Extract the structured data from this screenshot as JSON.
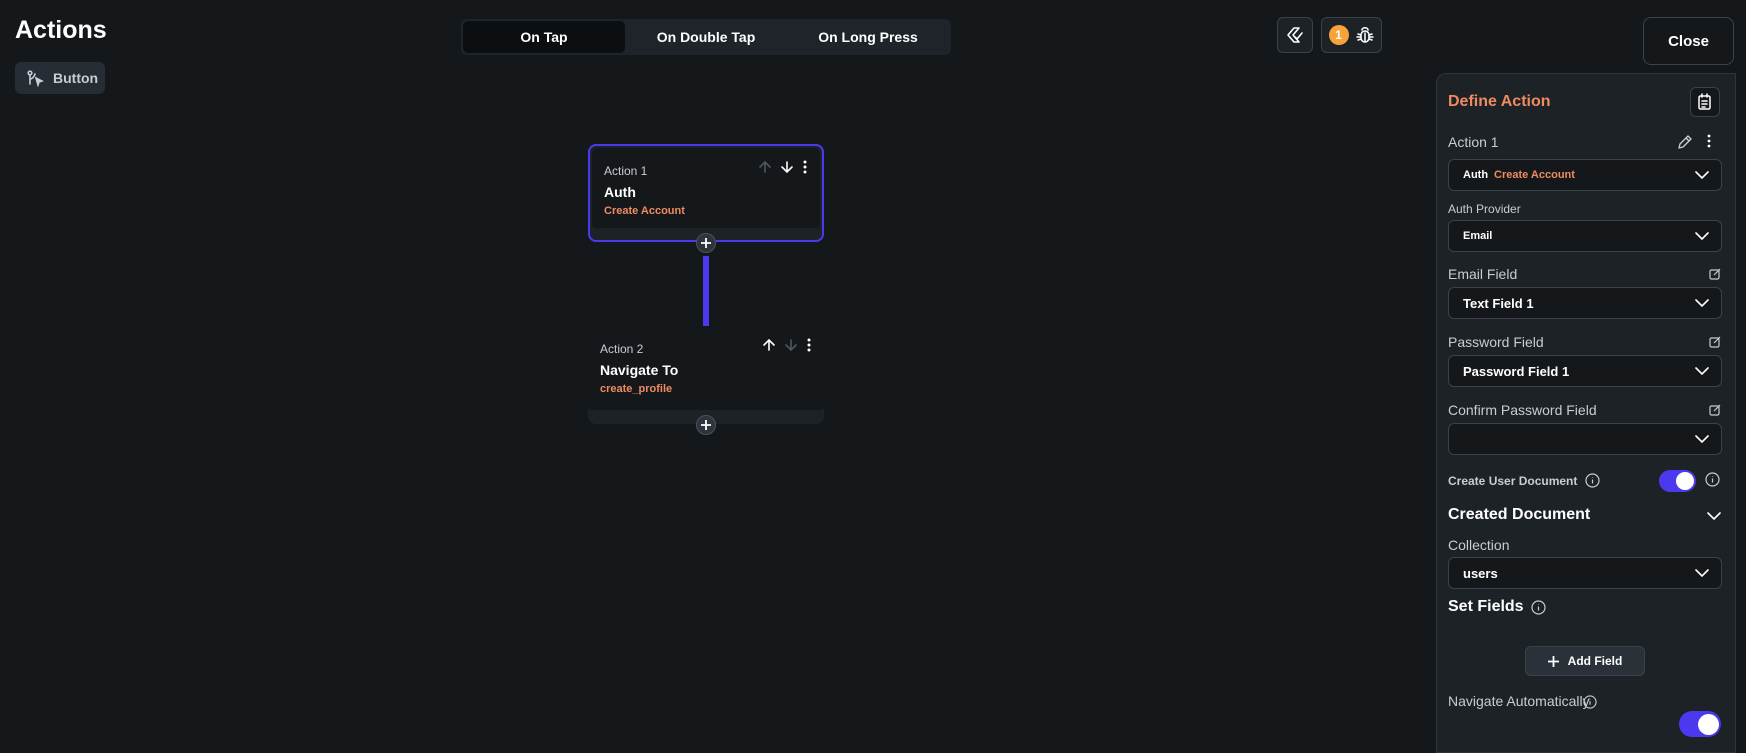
{
  "header": {
    "title": "Actions",
    "component_label": "Button",
    "tabs": [
      {
        "label": "On Tap",
        "active": true
      },
      {
        "label": "On Double Tap",
        "active": false
      },
      {
        "label": "On Long Press",
        "active": false
      }
    ],
    "issue_count": "1",
    "close_label": "Close"
  },
  "flow": {
    "actions": [
      {
        "label": "Action 1",
        "title": "Auth",
        "subtitle": "Create Account",
        "selected": true
      },
      {
        "label": "Action 2",
        "title": "Navigate To",
        "subtitle": "create_profile",
        "selected": false
      }
    ]
  },
  "panel": {
    "heading": "Define Action",
    "action_name": "Action 1",
    "action_type": {
      "prefix": "Auth",
      "value": "Create Account"
    },
    "auth_provider": {
      "label": "Auth Provider",
      "value": "Email"
    },
    "email_field": {
      "label": "Email Field",
      "value": "Text Field 1"
    },
    "password_field": {
      "label": "Password Field",
      "value": "Password Field 1"
    },
    "confirm_password_field": {
      "label": "Confirm Password Field",
      "value": ""
    },
    "create_user_document": {
      "label": "Create User Document",
      "enabled": true
    },
    "created_document": {
      "title": "Created Document",
      "collection_label": "Collection",
      "collection_value": "users"
    },
    "set_fields": {
      "title": "Set Fields",
      "add_label": "Add Field"
    },
    "navigate_automatically": {
      "label": "Navigate Automatically",
      "enabled": true
    }
  },
  "colors": {
    "background": "#14181b",
    "surface": "#1d2227",
    "accent": "#4b39ef",
    "highlight_text": "#ee8b60",
    "badge": "#f7a339"
  }
}
